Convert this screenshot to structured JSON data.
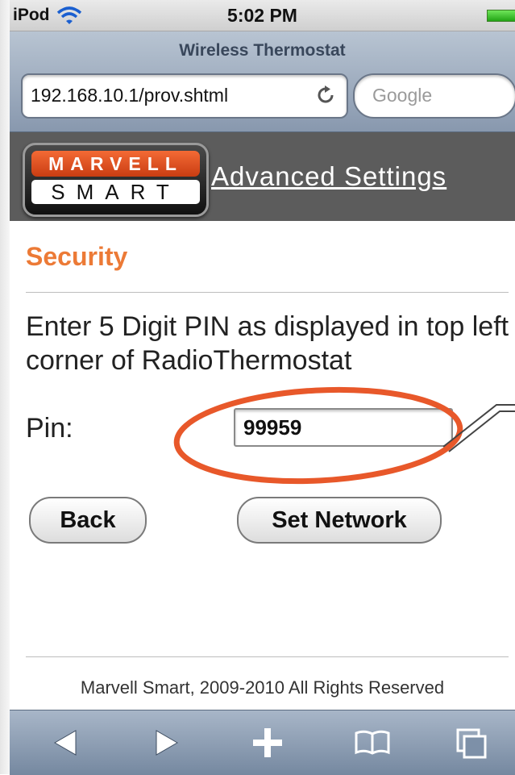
{
  "status": {
    "carrier": "iPod",
    "time": "5:02 PM"
  },
  "browser": {
    "page_title": "Wireless Thermostat",
    "url": "192.168.10.1/prov.shtml",
    "search_placeholder": "Google"
  },
  "header": {
    "logo_top": "MARVELL",
    "logo_bottom": "SMART",
    "link": "Advanced Settings"
  },
  "security": {
    "heading": "Security",
    "instructions": "Enter 5 Digit PIN as displayed in top left corner of RadioThermostat",
    "pin_label": "Pin:",
    "pin_value": "99959",
    "back_label": "Back",
    "set_network_label": "Set Network"
  },
  "footer": {
    "text": "Marvell Smart, 2009-2010 All Rights Reserved"
  },
  "toolbar": {
    "icons": [
      "back-arrow-icon",
      "forward-arrow-icon",
      "add-bookmark-icon",
      "bookmarks-icon",
      "pages-icon"
    ]
  },
  "colors": {
    "accent": "#ec7a36",
    "highlight": "#e8582a",
    "header_bg": "#5c5c5c"
  }
}
